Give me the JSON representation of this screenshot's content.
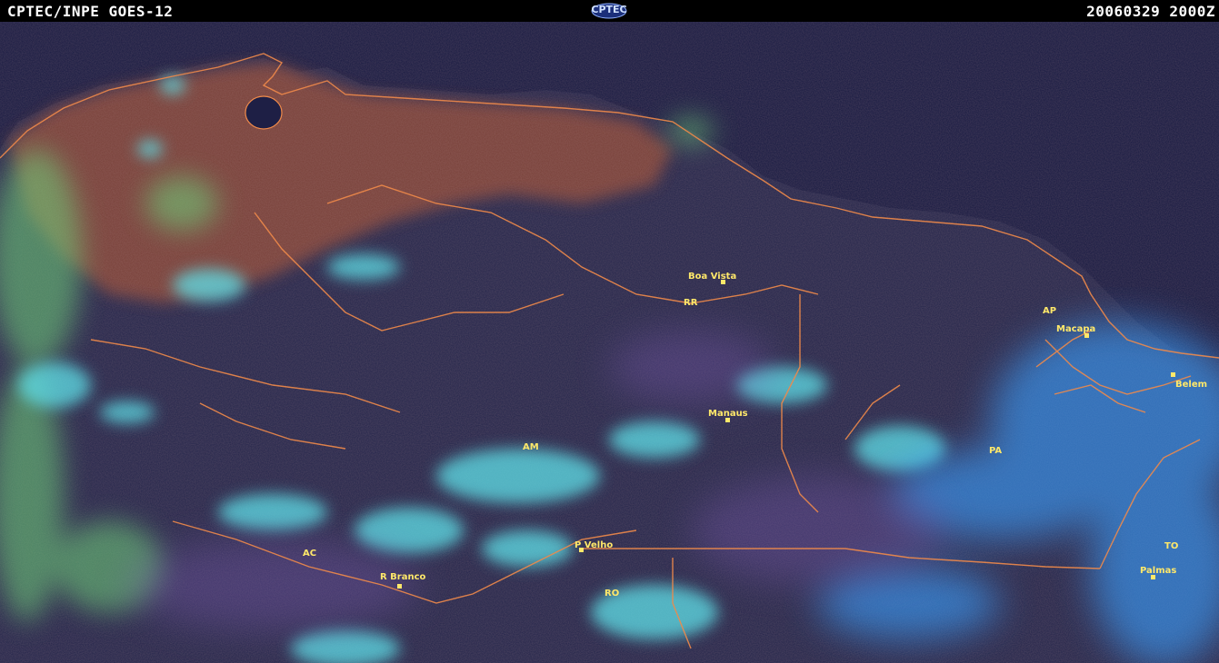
{
  "header": {
    "left_text": "CPTEC/INPE GOES-12",
    "logo_text": "CPTEC",
    "right_text": "20060329 2000Z"
  },
  "map": {
    "colors": {
      "ocean": "#1e1f45",
      "land_dark": "#2a2a4e",
      "land_warm": "#8a4a3a",
      "border": "#f08a4a",
      "cloud_green": "#6fd07a",
      "cloud_cyan": "#5fe0e8",
      "cloud_blue": "#3aa0ff",
      "label": "#ffe86a"
    },
    "states": {
      "rr": "RR",
      "ap": "AP",
      "am": "AM",
      "pa": "PA",
      "ac": "AC",
      "ro": "RO",
      "to": "TO"
    },
    "cities": {
      "boa_vista": "Boa Vista",
      "macapa": "Macapa",
      "belem": "Belem",
      "manaus": "Manaus",
      "p_velho": "P Velho",
      "r_branco": "R Branco",
      "palmas": "Palmas"
    }
  }
}
